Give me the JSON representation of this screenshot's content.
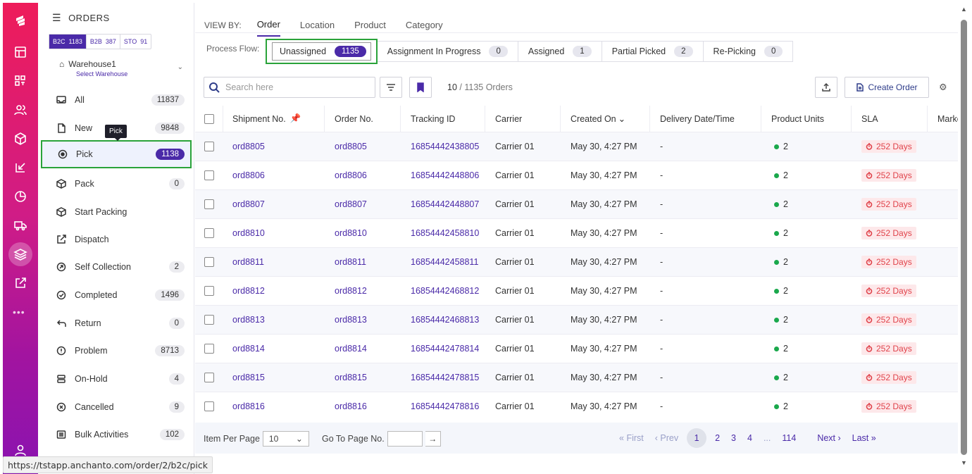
{
  "sidebar": {
    "title": "ORDERS",
    "segments": [
      {
        "label": "B2C",
        "count": "1183"
      },
      {
        "label": "B2B",
        "count": "387"
      },
      {
        "label": "STO",
        "count": "91"
      }
    ],
    "warehouse": {
      "name": "Warehouse1",
      "sub": "Select Warehouse"
    },
    "items": [
      {
        "label": "All",
        "count": "11837",
        "icon": "inbox-icon"
      },
      {
        "label": "New",
        "count": "9848",
        "icon": "document-icon"
      },
      {
        "label": "Pick",
        "count": "1138",
        "icon": "target-icon"
      },
      {
        "label": "Pack",
        "count": "0",
        "icon": "box-icon"
      },
      {
        "label": "Start Packing",
        "count": "",
        "icon": "box-icon"
      },
      {
        "label": "Dispatch",
        "count": "",
        "icon": "external-link-icon"
      },
      {
        "label": "Self Collection",
        "count": "2",
        "icon": "self-collection-icon"
      },
      {
        "label": "Completed",
        "count": "1496",
        "icon": "check-circle-icon"
      },
      {
        "label": "Return",
        "count": "0",
        "icon": "return-icon"
      },
      {
        "label": "Problem",
        "count": "8713",
        "icon": "alert-icon"
      },
      {
        "label": "On-Hold",
        "count": "4",
        "icon": "hold-icon"
      },
      {
        "label": "Cancelled",
        "count": "9",
        "icon": "x-circle-icon"
      },
      {
        "label": "Bulk Activities",
        "count": "102",
        "icon": "bulk-icon"
      }
    ],
    "tooltip": "Pick"
  },
  "viewby": {
    "label": "VIEW BY:",
    "tabs": [
      "Order",
      "Location",
      "Product",
      "Category"
    ]
  },
  "process_flow": {
    "label": "Process Flow:",
    "items": [
      {
        "label": "Unassigned",
        "count": "1135"
      },
      {
        "label": "Assignment In Progress",
        "count": "0"
      },
      {
        "label": "Assigned",
        "count": "1"
      },
      {
        "label": "Partial Picked",
        "count": "2"
      },
      {
        "label": "Re-Picking",
        "count": "0"
      }
    ]
  },
  "toolbar": {
    "search_placeholder": "Search here",
    "count_shown": "10",
    "count_total": "/ 1135 Orders",
    "create_label": "Create Order"
  },
  "table": {
    "headers": [
      "Shipment No.",
      "Order No.",
      "Tracking ID",
      "Carrier",
      "Created On",
      "Delivery Date/Time",
      "Product Units",
      "SLA",
      "Marke"
    ],
    "rows": [
      [
        "ord8805",
        "ord8805",
        "16854442438805",
        "Carrier 01",
        "May 30, 4:27 PM",
        "-",
        "2",
        "252 Days"
      ],
      [
        "ord8806",
        "ord8806",
        "16854442448806",
        "Carrier 01",
        "May 30, 4:27 PM",
        "-",
        "2",
        "252 Days"
      ],
      [
        "ord8807",
        "ord8807",
        "16854442448807",
        "Carrier 01",
        "May 30, 4:27 PM",
        "-",
        "2",
        "252 Days"
      ],
      [
        "ord8810",
        "ord8810",
        "16854442458810",
        "Carrier 01",
        "May 30, 4:27 PM",
        "-",
        "2",
        "252 Days"
      ],
      [
        "ord8811",
        "ord8811",
        "16854442458811",
        "Carrier 01",
        "May 30, 4:27 PM",
        "-",
        "2",
        "252 Days"
      ],
      [
        "ord8812",
        "ord8812",
        "16854442468812",
        "Carrier 01",
        "May 30, 4:27 PM",
        "-",
        "2",
        "252 Days"
      ],
      [
        "ord8813",
        "ord8813",
        "16854442468813",
        "Carrier 01",
        "May 30, 4:27 PM",
        "-",
        "2",
        "252 Days"
      ],
      [
        "ord8814",
        "ord8814",
        "16854442478814",
        "Carrier 01",
        "May 30, 4:27 PM",
        "-",
        "2",
        "252 Days"
      ],
      [
        "ord8815",
        "ord8815",
        "16854442478815",
        "Carrier 01",
        "May 30, 4:27 PM",
        "-",
        "2",
        "252 Days"
      ],
      [
        "ord8816",
        "ord8816",
        "16854442478816",
        "Carrier 01",
        "May 30, 4:27 PM",
        "-",
        "2",
        "252 Days"
      ]
    ]
  },
  "footer": {
    "items_per_page_label": "Item Per Page",
    "items_per_page_value": "10",
    "goto_label": "Go To Page No.",
    "first": "First",
    "prev": "Prev",
    "pages": [
      "1",
      "2",
      "3",
      "4",
      "...",
      "114"
    ],
    "next": "Next",
    "last": "Last"
  },
  "statusbar": {
    "url": "https://tstapp.anchanto.com/order/2/b2c/pick"
  },
  "colors": {
    "accent": "#4a2aa8",
    "highlight": "#2aa33a",
    "rail_top": "#ee1c5a",
    "rail_bottom": "#8a13b0",
    "sla_text": "#e0434b"
  }
}
